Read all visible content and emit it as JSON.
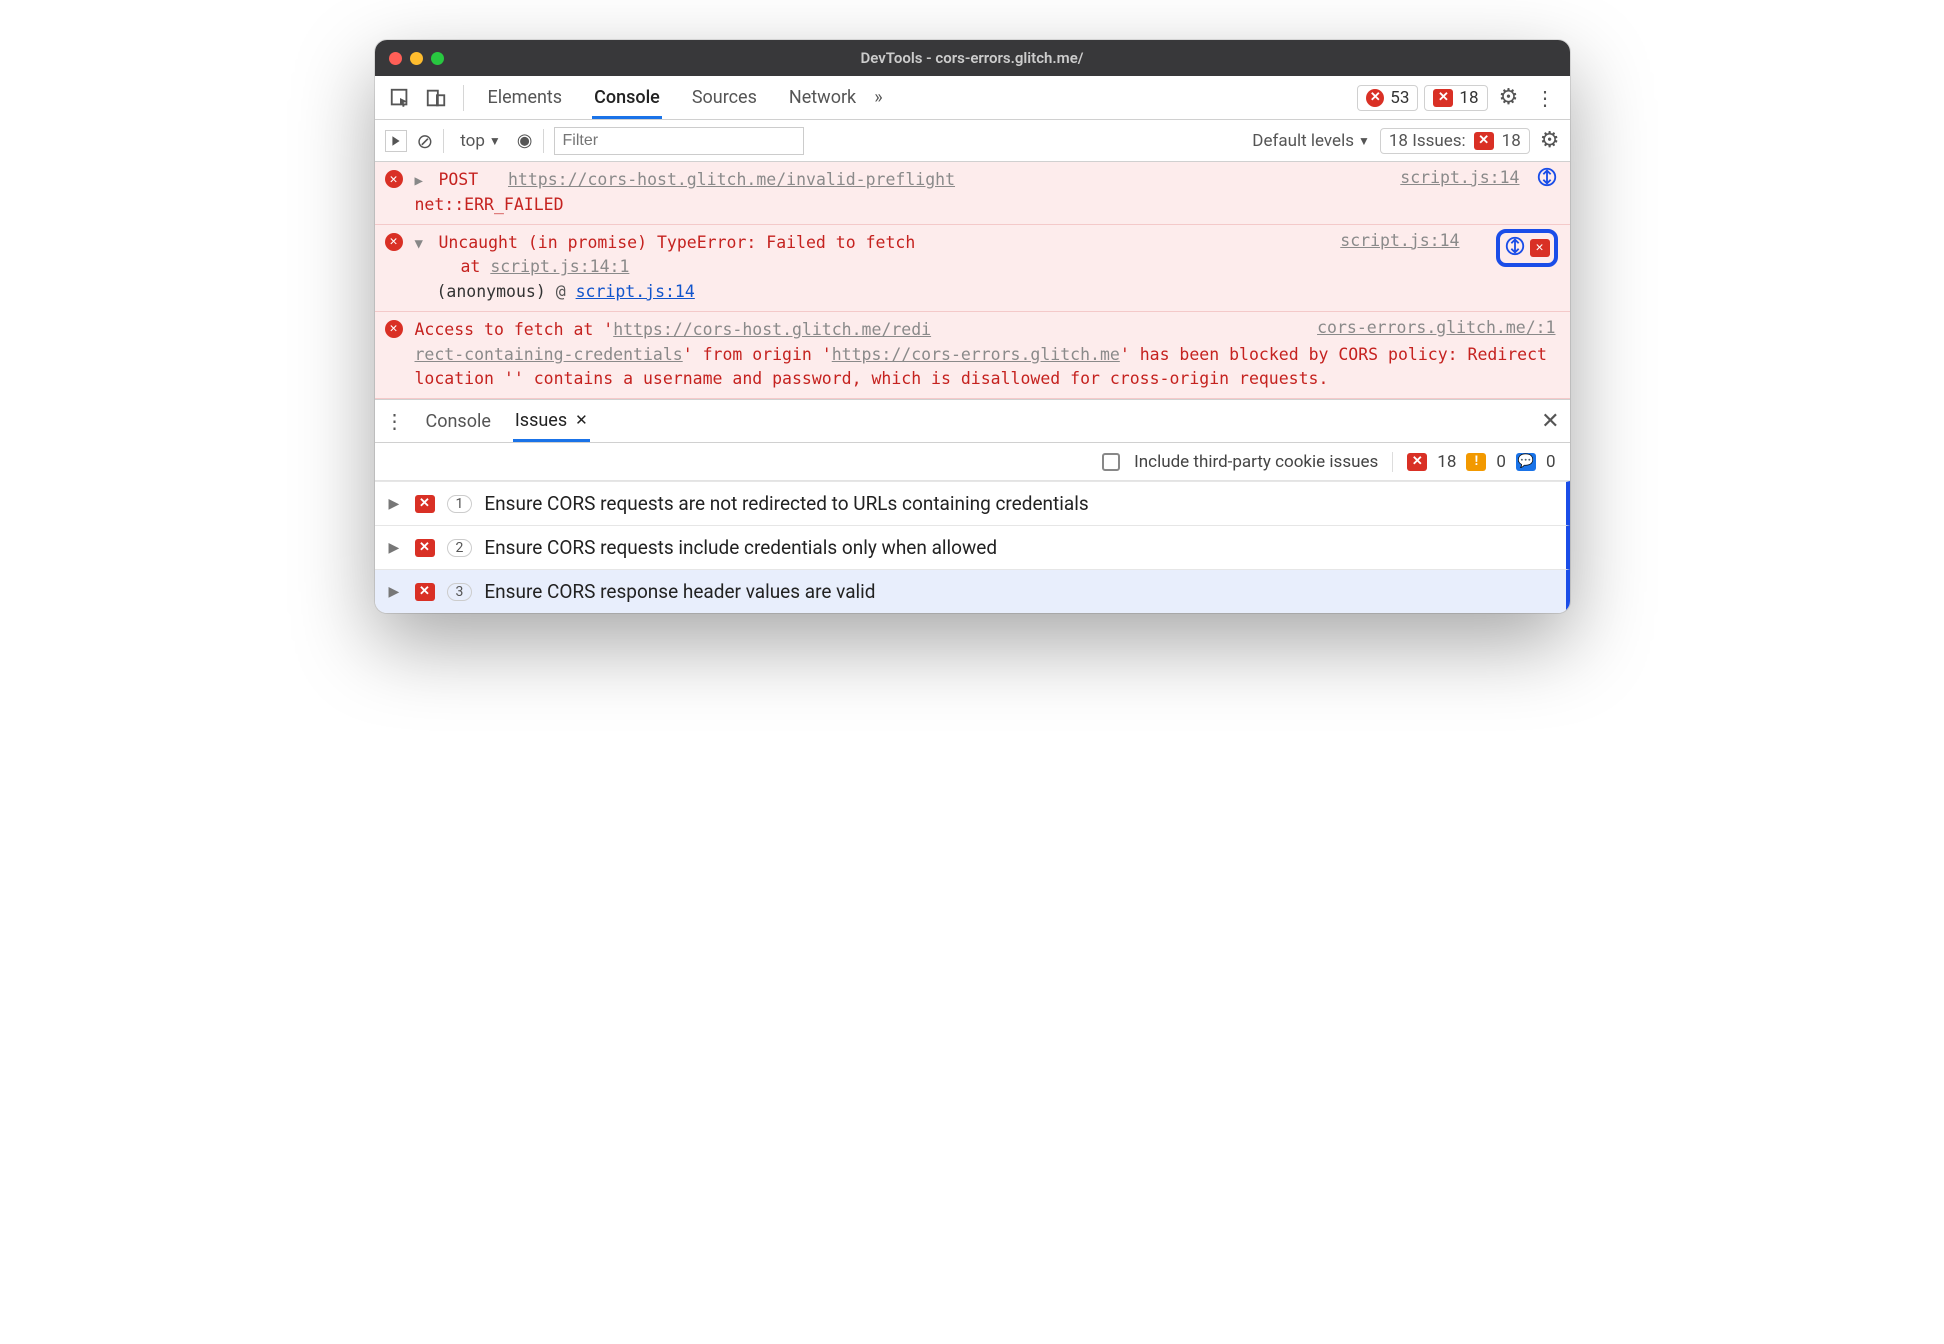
{
  "window": {
    "title": "DevTools - cors-errors.glitch.me/"
  },
  "tabs": {
    "items": [
      "Elements",
      "Console",
      "Sources",
      "Network"
    ],
    "active": "Console",
    "overflow": "»"
  },
  "counters": {
    "errors": "53",
    "issues": "18"
  },
  "toolbar": {
    "context": "top",
    "context_arrow": "▼",
    "filter_placeholder": "Filter",
    "levels_label": "Default levels",
    "levels_arrow": "▼",
    "issues_label": "18 Issues:",
    "issues_count": "18"
  },
  "console": {
    "msg1": {
      "method": "POST",
      "url": "https://cors-host.glitch.me/invalid-preflight",
      "err": "net::ERR_FAILED",
      "loc": "script.js:14"
    },
    "msg2": {
      "line1": "Uncaught (in promise) TypeError: Failed to fetch",
      "line2_prefix": "at ",
      "line2_link": "script.js:14:1",
      "stack_label": "(anonymous)",
      "stack_at": "@",
      "stack_link": "script.js:14",
      "loc": "script.js:14"
    },
    "msg3": {
      "pre": "Access to fetch at '",
      "url1a": "https://cors-host.glitch.me/redi",
      "url1b": "rect-containing-credentials",
      "mid1": "' from origin '",
      "url2": "https://cors-errors.glitch.me",
      "tail": "' has been blocked by CORS policy: Redirect location '' contains a username and password, which is disallowed for cross-origin requests.",
      "loc": "cors-errors.glitch.me/:1"
    }
  },
  "drawer": {
    "tabs": {
      "console": "Console",
      "issues": "Issues"
    },
    "checkbox_label": "Include third-party cookie issues",
    "counts": {
      "err": "18",
      "warn": "0",
      "info": "0"
    },
    "rows": [
      {
        "count": "1",
        "text": "Ensure CORS requests are not redirected to URLs containing credentials"
      },
      {
        "count": "2",
        "text": "Ensure CORS requests include credentials only when allowed"
      },
      {
        "count": "3",
        "text": "Ensure CORS response header values are valid"
      }
    ]
  }
}
